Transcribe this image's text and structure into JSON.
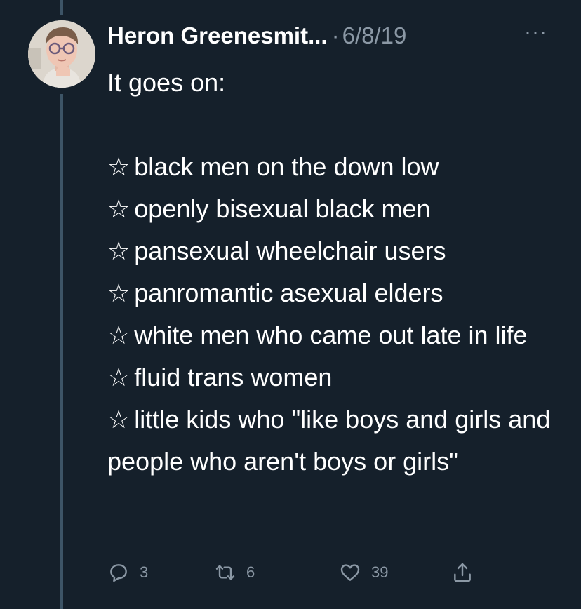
{
  "tweet": {
    "author": "Heron Greenesmit...",
    "separator": "·",
    "date": "6/8/19",
    "more_label": "···",
    "intro": "It goes on:",
    "star": "☆",
    "items": [
      "black men on the down low",
      "openly bisexual black men",
      "pansexual wheelchair users",
      "panromantic asexual elders",
      "white men who came out late in life",
      "fluid trans women",
      "little kids who \"like boys and girls and people who aren't boys or girls\""
    ]
  },
  "actions": {
    "reply_count": "3",
    "retweet_count": "6",
    "like_count": "39"
  },
  "colors": {
    "background": "#15202b",
    "text": "#ffffff",
    "secondary": "#8b98a5",
    "thread_line": "#3d5466"
  },
  "icons": [
    "reply-icon",
    "retweet-icon",
    "like-icon",
    "share-icon",
    "more-icon"
  ]
}
